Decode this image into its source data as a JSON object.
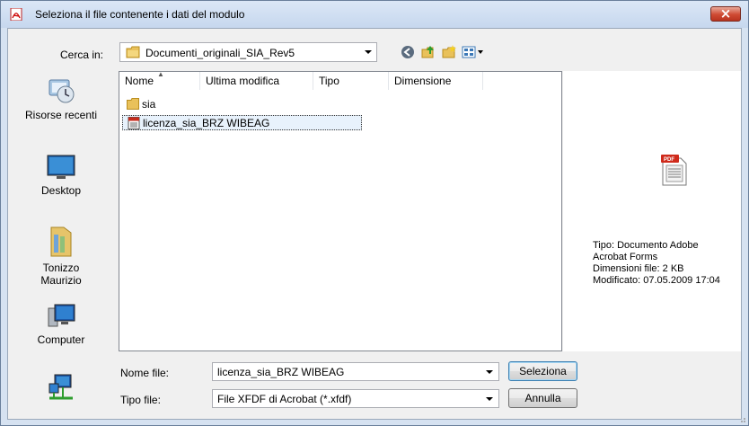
{
  "dialog": {
    "title": "Seleziona il file contenente i dati del modulo"
  },
  "lookin": {
    "label": "Cerca in:",
    "value": "Documenti_originali_SIA_Rev5"
  },
  "toolbar": {
    "icons": [
      "back-icon",
      "up-folder-icon",
      "new-folder-icon",
      "view-menu-icon"
    ]
  },
  "places": [
    {
      "label": "Risorse recenti",
      "icon": "recent-places-icon"
    },
    {
      "label": "Desktop",
      "icon": "desktop-icon"
    },
    {
      "label": "Tonizzo\nMaurizio",
      "icon": "user-folder-icon"
    },
    {
      "label": "Computer",
      "icon": "computer-icon"
    },
    {
      "label": "",
      "icon": "network-icon"
    }
  ],
  "columns": [
    "Nome",
    "Ultima modifica",
    "Tipo",
    "Dimensione"
  ],
  "files": [
    {
      "name": "sia",
      "icon": "folder-icon"
    },
    {
      "name": "licenza_sia_BRZ WIBEAG",
      "icon": "xfdf-file-icon"
    }
  ],
  "preview": {
    "info_line1": "Tipo: Documento Adobe",
    "info_line2": "Acrobat Forms",
    "info_line3": "Dimensioni file: 2 KB",
    "info_line4": "Modificato: 07.05.2009 17:04"
  },
  "filename": {
    "label": "Nome file:",
    "value": "licenza_sia_BRZ WIBEAG"
  },
  "filetype": {
    "label": "Tipo file:",
    "value": "File XFDF di Acrobat (*.xfdf)"
  },
  "buttons": {
    "open": "Seleziona",
    "cancel": "Annulla"
  }
}
